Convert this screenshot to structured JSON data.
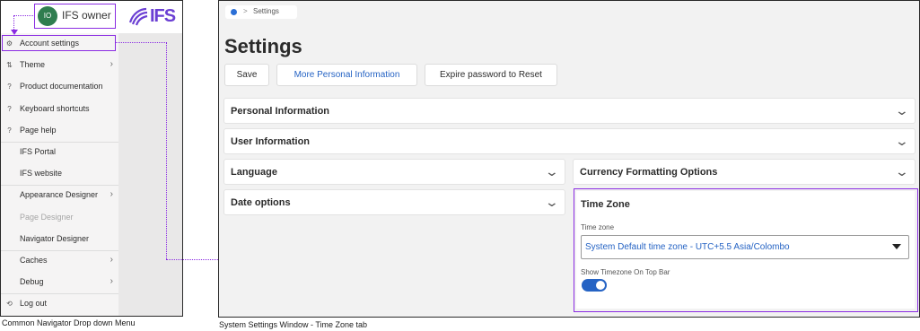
{
  "navigator": {
    "avatar_initials": "IO",
    "owner_name": "IFS owner",
    "logo_text": "IFS",
    "items": [
      {
        "label": "Account settings",
        "icon": "gear-icon",
        "glyph": "⚙",
        "chevron": false,
        "dim": false
      },
      {
        "label": "Theme",
        "icon": "theme-icon",
        "glyph": "⇅",
        "chevron": true,
        "dim": false
      },
      {
        "label": "Product documentation",
        "icon": "help-circle-icon",
        "glyph": "?",
        "chevron": false,
        "dim": false
      },
      {
        "label": "Keyboard shortcuts",
        "icon": "help-circle-icon",
        "glyph": "?",
        "chevron": false,
        "dim": false
      },
      {
        "label": "Page help",
        "icon": "help-circle-icon",
        "glyph": "?",
        "chevron": false,
        "dim": false
      },
      {
        "label": "IFS Portal",
        "icon": "",
        "glyph": "",
        "chevron": false,
        "dim": false
      },
      {
        "label": "IFS website",
        "icon": "",
        "glyph": "",
        "chevron": false,
        "dim": false
      },
      {
        "label": "Appearance Designer",
        "icon": "",
        "glyph": "",
        "chevron": true,
        "dim": false
      },
      {
        "label": "Page Designer",
        "icon": "",
        "glyph": "",
        "chevron": false,
        "dim": true
      },
      {
        "label": "Navigator Designer",
        "icon": "",
        "glyph": "",
        "chevron": false,
        "dim": false
      },
      {
        "label": "Caches",
        "icon": "",
        "glyph": "",
        "chevron": true,
        "dim": false
      },
      {
        "label": "Debug",
        "icon": "",
        "glyph": "",
        "chevron": true,
        "dim": false
      },
      {
        "label": "Log out",
        "icon": "logout-icon",
        "glyph": "⟲",
        "chevron": false,
        "dim": false
      }
    ]
  },
  "captions": {
    "left": "Common Navigator Drop down Menu",
    "right": "System Settings Window - Time Zone tab"
  },
  "settings": {
    "breadcrumb": "Settings",
    "title": "Settings",
    "buttons": {
      "save": "Save",
      "more": "More Personal Information",
      "expire": "Expire password to Reset"
    },
    "sections": {
      "personal": "Personal Information",
      "user": "User Information",
      "language": "Language",
      "currency": "Currency Formatting Options",
      "date": "Date options"
    },
    "timezone": {
      "title": "Time Zone",
      "field_label": "Time zone",
      "value": "System Default time zone - UTC+5.5 Asia/Colombo",
      "toggle_label": "Show Timezone On Top Bar",
      "toggle_on": true
    }
  },
  "colors": {
    "highlight": "#8a2be2",
    "accent": "#2563c4",
    "logo": "#6b3fd3",
    "avatar": "#2f7d4f"
  }
}
